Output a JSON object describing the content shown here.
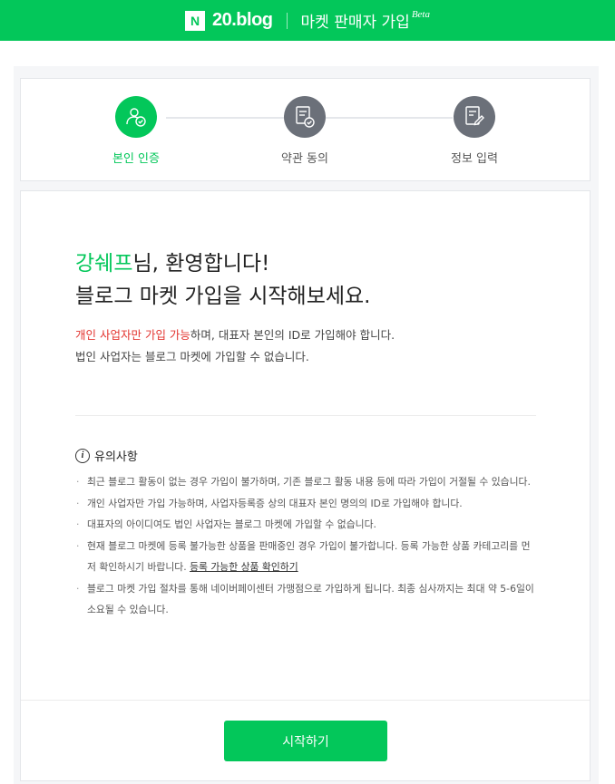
{
  "header": {
    "logo_letter": "N",
    "logo_text": "20.blog",
    "title": "마켓 판매자 가입",
    "badge": "Beta",
    "brand_color": "#03c75a"
  },
  "steps": [
    {
      "label": "본인 인증",
      "status": "active",
      "icon": "user-check-icon"
    },
    {
      "label": "약관 동의",
      "status": "inactive",
      "icon": "document-check-icon"
    },
    {
      "label": "정보 입력",
      "status": "inactive",
      "icon": "document-edit-icon"
    }
  ],
  "welcome": {
    "name": "강쉐프",
    "line1_suffix": "님, 환영합니다!",
    "line2": "블로그 마켓 가입을 시작해보세요."
  },
  "description": {
    "highlight": "개인 사업자만 가입 가능",
    "line1_rest": "하며, 대표자 본인의 ID로 가입해야 합니다.",
    "line2": "법인 사업자는 블로그 마켓에 가입할 수 없습니다."
  },
  "notice": {
    "icon": "info-icon",
    "title": "유의사항",
    "items": [
      {
        "text": "최근 블로그 활동이 없는 경우 가입이 불가하며, 기존 블로그 활동 내용 등에 따라 가입이 거절될 수 있습니다."
      },
      {
        "text": "개인 사업자만 가입 가능하며, 사업자등록증 상의 대표자 본인 명의의 ID로 가입해야 합니다."
      },
      {
        "text": "대표자의 아이디여도 법인 사업자는 블로그 마켓에 가입할 수 없습니다."
      },
      {
        "text": "현재 블로그 마켓에 등록 불가능한 상품을 판매중인 경우 가입이 불가합니다. 등록 가능한 상품 카테고리를 먼저 확인하시기 바랍니다. ",
        "link": "등록 가능한 상품 확인하기"
      },
      {
        "text": "블로그 마켓 가입 절차를 통해 네이버페이센터 가맹점으로 가입하게 됩니다. 최종 심사까지는 최대 약 5-6일이 소요될 수 있습니다."
      }
    ]
  },
  "start_button": "시작하기"
}
